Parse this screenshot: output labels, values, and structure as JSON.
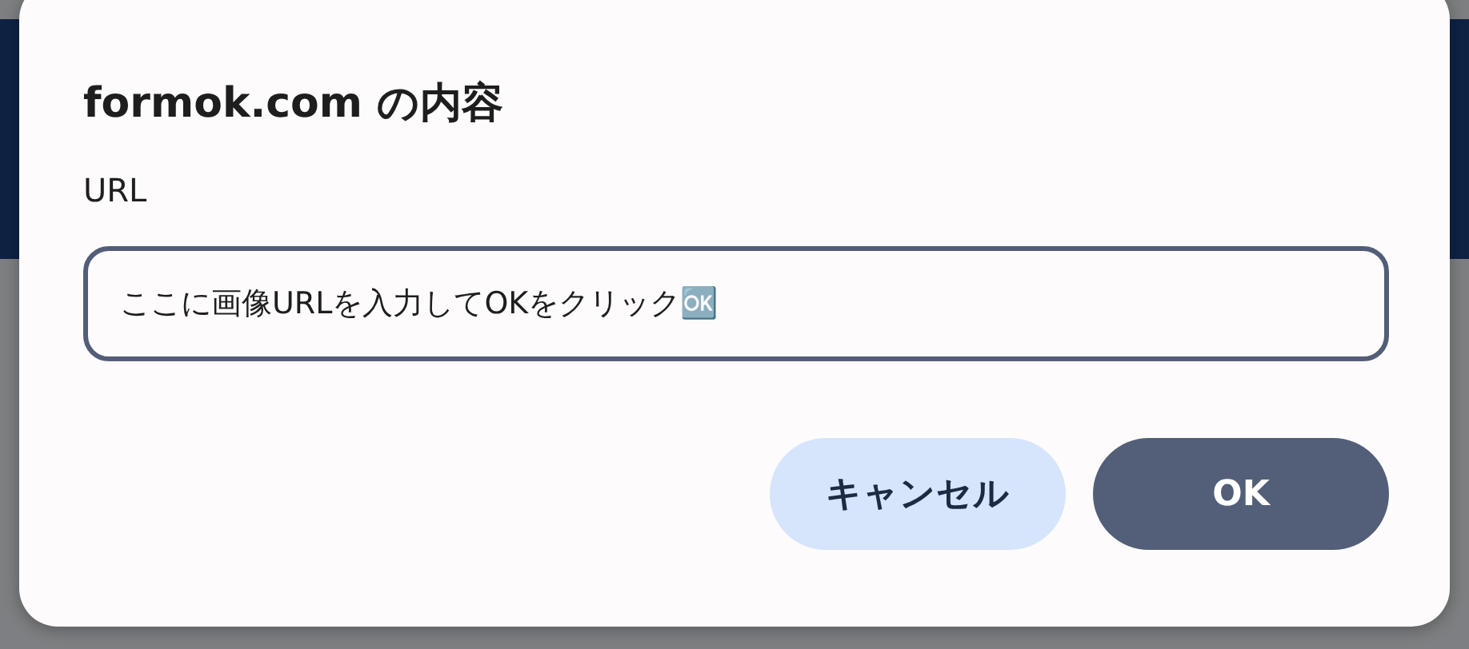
{
  "dialog": {
    "title": "formok.com の内容",
    "label": "URL",
    "field": {
      "value": "ここに画像URLを入力してOKをクリック🆗"
    },
    "buttons": [
      {
        "label": "キャンセル",
        "kind": "secondary"
      },
      {
        "label": "OK",
        "kind": "primary"
      }
    ]
  }
}
